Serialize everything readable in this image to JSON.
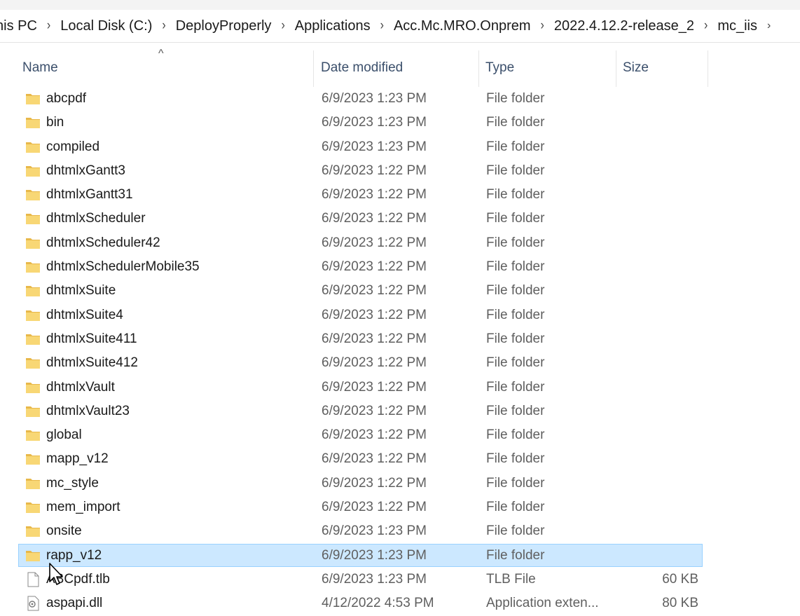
{
  "breadcrumb": {
    "items": [
      "his PC",
      "Local Disk (C:)",
      "DeployProperly",
      "Applications",
      "Acc.Mc.MRO.Onprem",
      "2022.4.12.2-release_2",
      "mc_iis"
    ]
  },
  "columns": {
    "name": "Name",
    "date": "Date modified",
    "type": "Type",
    "size": "Size"
  },
  "files": [
    {
      "name": "abcpdf",
      "date": "6/9/2023 1:23 PM",
      "type": "File folder",
      "size": "",
      "icon": "folder-icon"
    },
    {
      "name": "bin",
      "date": "6/9/2023 1:23 PM",
      "type": "File folder",
      "size": "",
      "icon": "folder-icon"
    },
    {
      "name": "compiled",
      "date": "6/9/2023 1:23 PM",
      "type": "File folder",
      "size": "",
      "icon": "folder-icon"
    },
    {
      "name": "dhtmlxGantt3",
      "date": "6/9/2023 1:22 PM",
      "type": "File folder",
      "size": "",
      "icon": "folder-icon"
    },
    {
      "name": "dhtmlxGantt31",
      "date": "6/9/2023 1:22 PM",
      "type": "File folder",
      "size": "",
      "icon": "folder-icon"
    },
    {
      "name": "dhtmlxScheduler",
      "date": "6/9/2023 1:22 PM",
      "type": "File folder",
      "size": "",
      "icon": "folder-icon"
    },
    {
      "name": "dhtmlxScheduler42",
      "date": "6/9/2023 1:22 PM",
      "type": "File folder",
      "size": "",
      "icon": "folder-icon"
    },
    {
      "name": "dhtmlxSchedulerMobile35",
      "date": "6/9/2023 1:22 PM",
      "type": "File folder",
      "size": "",
      "icon": "folder-icon"
    },
    {
      "name": "dhtmlxSuite",
      "date": "6/9/2023 1:22 PM",
      "type": "File folder",
      "size": "",
      "icon": "folder-icon"
    },
    {
      "name": "dhtmlxSuite4",
      "date": "6/9/2023 1:22 PM",
      "type": "File folder",
      "size": "",
      "icon": "folder-icon"
    },
    {
      "name": "dhtmlxSuite411",
      "date": "6/9/2023 1:22 PM",
      "type": "File folder",
      "size": "",
      "icon": "folder-icon"
    },
    {
      "name": "dhtmlxSuite412",
      "date": "6/9/2023 1:22 PM",
      "type": "File folder",
      "size": "",
      "icon": "folder-icon"
    },
    {
      "name": "dhtmlxVault",
      "date": "6/9/2023 1:22 PM",
      "type": "File folder",
      "size": "",
      "icon": "folder-icon"
    },
    {
      "name": "dhtmlxVault23",
      "date": "6/9/2023 1:22 PM",
      "type": "File folder",
      "size": "",
      "icon": "folder-icon"
    },
    {
      "name": "global",
      "date": "6/9/2023 1:22 PM",
      "type": "File folder",
      "size": "",
      "icon": "folder-icon"
    },
    {
      "name": "mapp_v12",
      "date": "6/9/2023 1:22 PM",
      "type": "File folder",
      "size": "",
      "icon": "folder-icon"
    },
    {
      "name": "mc_style",
      "date": "6/9/2023 1:22 PM",
      "type": "File folder",
      "size": "",
      "icon": "folder-icon"
    },
    {
      "name": "mem_import",
      "date": "6/9/2023 1:22 PM",
      "type": "File folder",
      "size": "",
      "icon": "folder-icon"
    },
    {
      "name": "onsite",
      "date": "6/9/2023 1:23 PM",
      "type": "File folder",
      "size": "",
      "icon": "folder-icon"
    },
    {
      "name": "rapp_v12",
      "date": "6/9/2023 1:23 PM",
      "type": "File folder",
      "size": "",
      "icon": "folder-icon",
      "selected": true
    },
    {
      "name": "ABCpdf.tlb",
      "date": "6/9/2023 1:23 PM",
      "type": "TLB File",
      "size": "60 KB",
      "icon": "file-icon"
    },
    {
      "name": "aspapi.dll",
      "date": "4/12/2022 4:53 PM",
      "type": "Application exten...",
      "size": "80 KB",
      "icon": "dll-icon"
    }
  ],
  "colors": {
    "selection_bg": "#cce8ff",
    "selection_border": "#99d1ff",
    "folder": "#f8d775",
    "header_text": "#3b4f6b"
  }
}
